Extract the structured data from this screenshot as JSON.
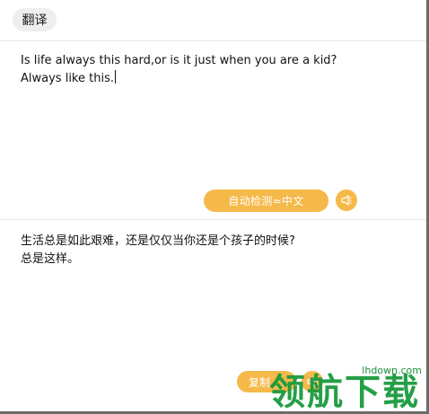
{
  "tab": {
    "label": "翻译"
  },
  "source": {
    "text": "Is life always this hard,or is it just when you are a kid?\nAlways like this."
  },
  "language_button": {
    "label": "自动检测≈中文"
  },
  "target": {
    "text": "生活总是如此艰难，还是仅仅当你还是个孩子的时候?\n总是这样。"
  },
  "copy_button": {
    "label": "复制"
  },
  "watermark": {
    "text": "领航下载",
    "url": "lhdown.com"
  },
  "icons": {
    "speaker": "speaker-icon"
  },
  "colors": {
    "accent": "#f5b94a",
    "watermark": "#1a9a3e"
  }
}
